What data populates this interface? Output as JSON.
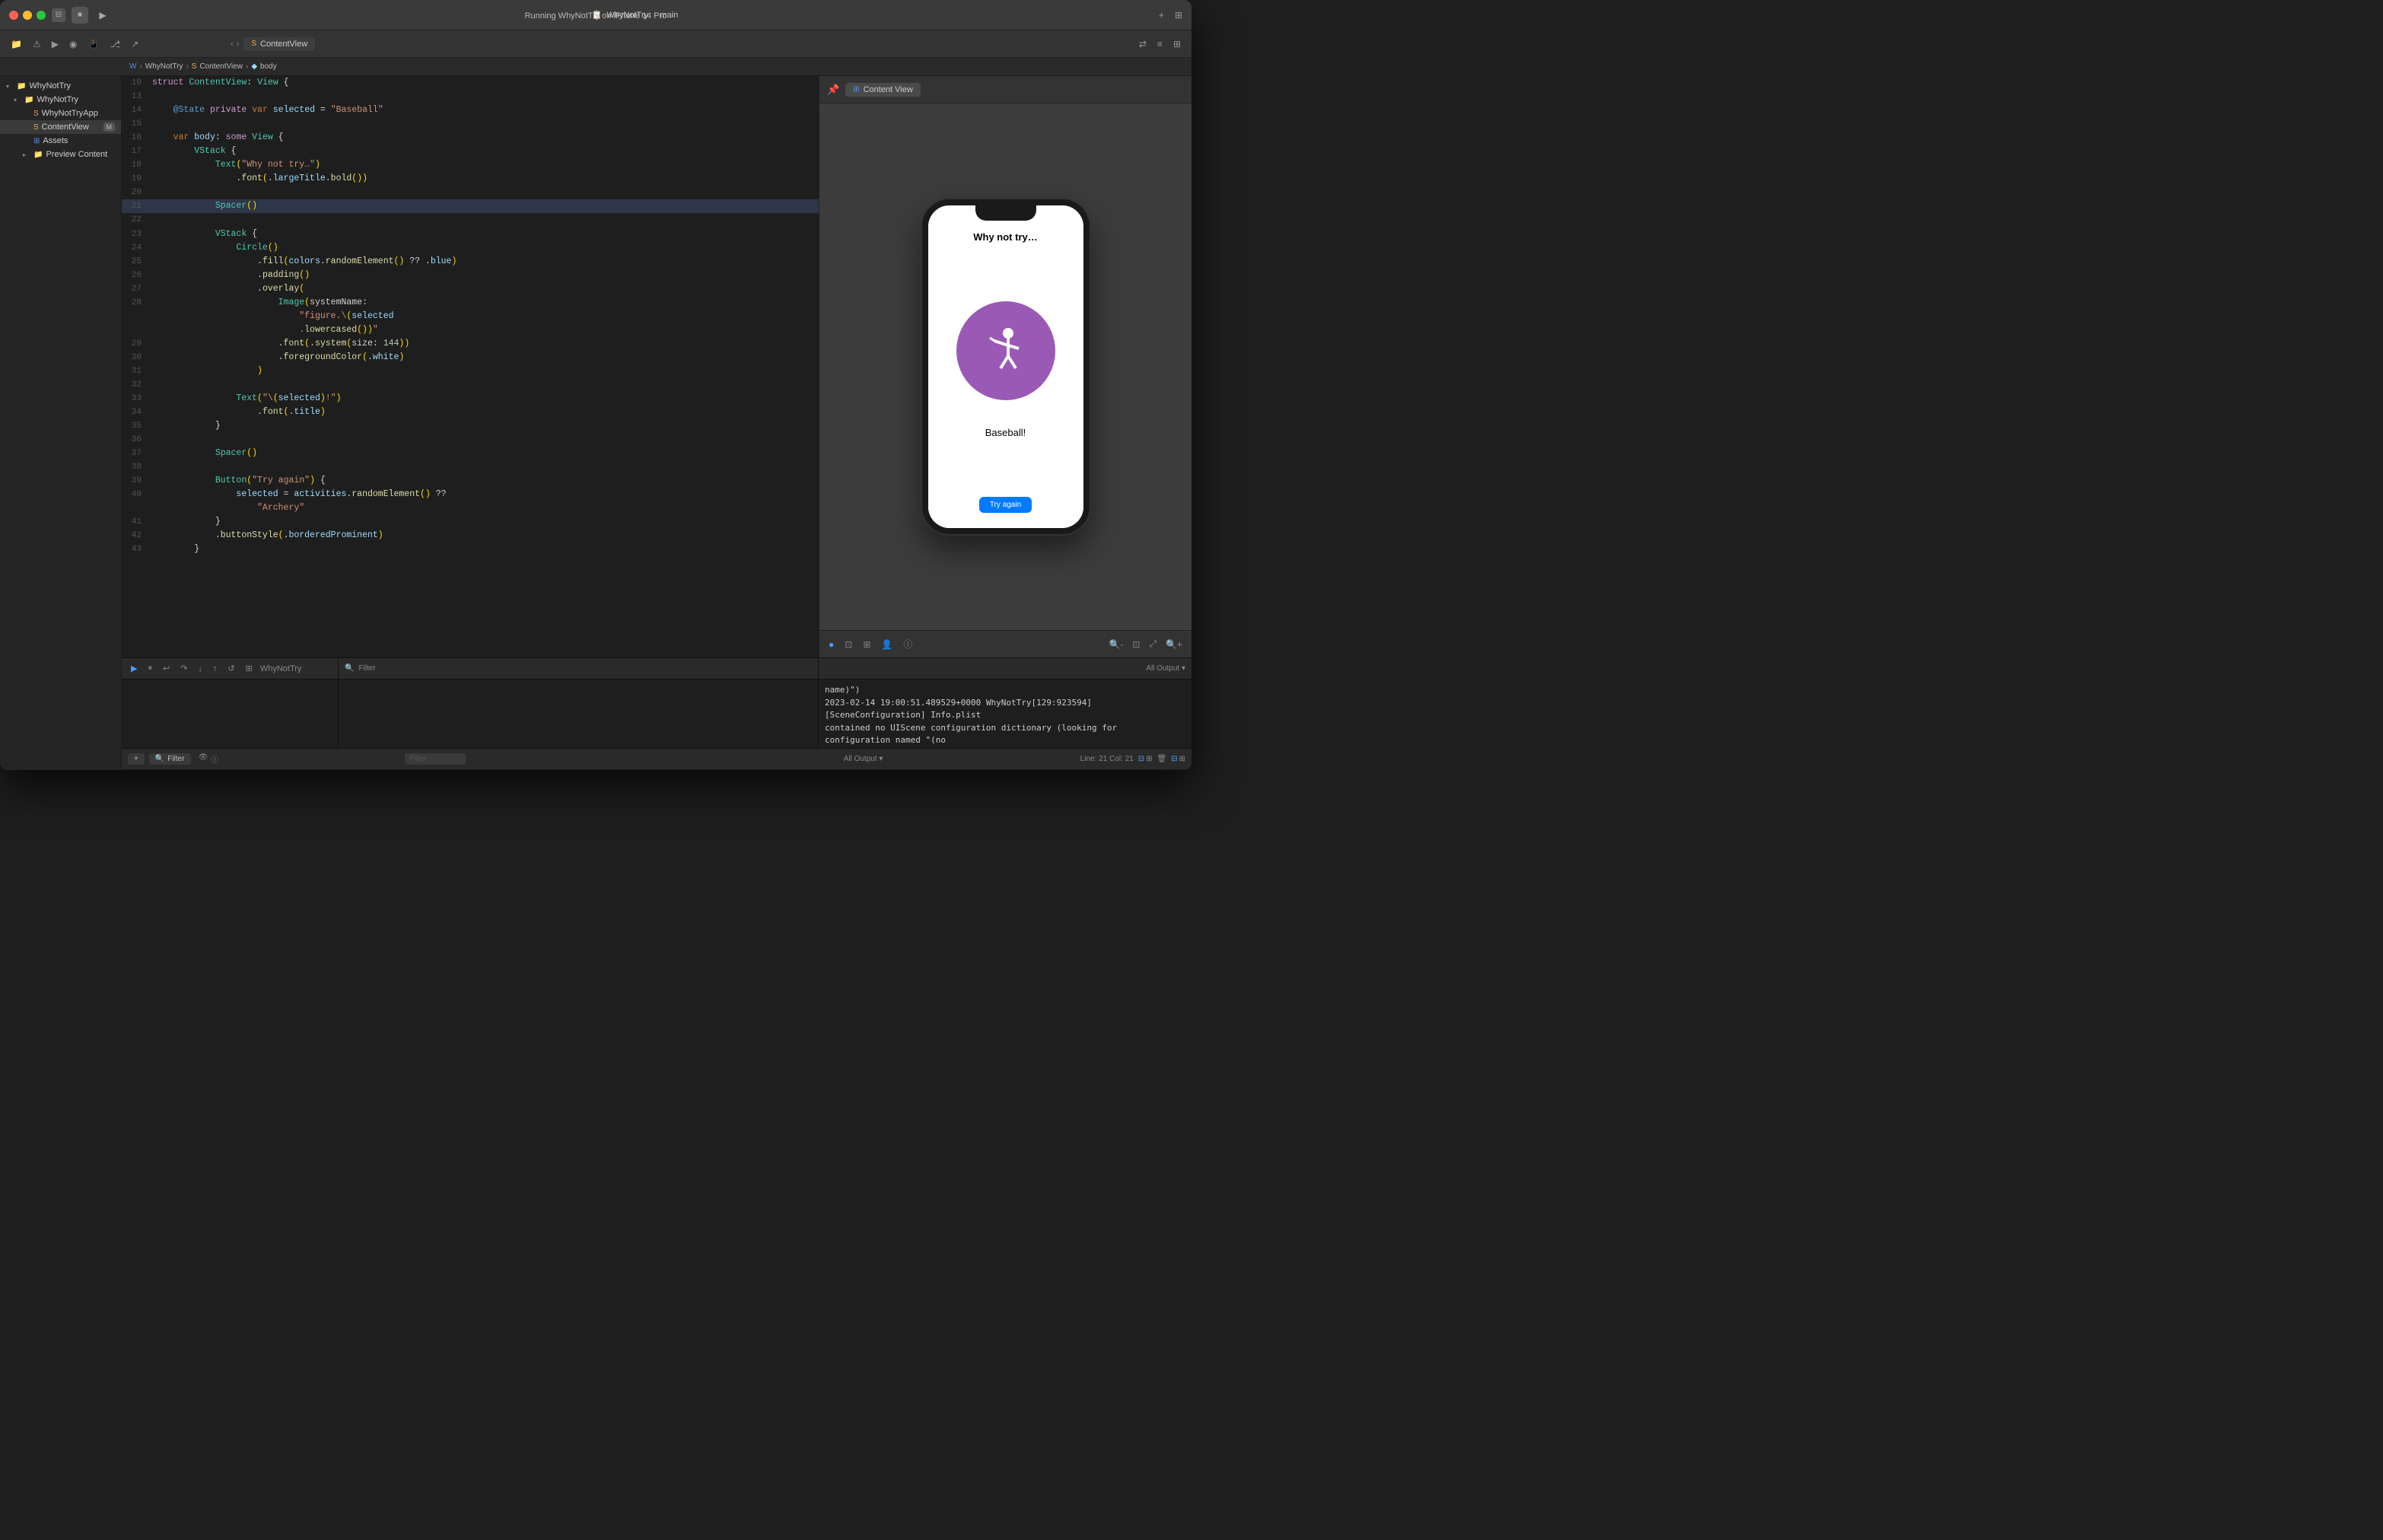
{
  "window": {
    "title": "WhyNotTry",
    "subtitle": "main",
    "status": "Running WhyNotTry on iPhone 14 Pro",
    "device": "iPhone 14 Pro",
    "project": "WhyNotTry"
  },
  "titlebar": {
    "breadcrumb": [
      "WhyNotTry",
      "WhyNotTry",
      "ContentView",
      "body"
    ],
    "tab_label": "ContentView",
    "add_label": "+",
    "layout_label": "⊞"
  },
  "sidebar": {
    "items": [
      {
        "label": "WhyNotTry",
        "level": 0,
        "type": "folder",
        "expanded": true
      },
      {
        "label": "WhyNotTry",
        "level": 1,
        "type": "folder",
        "expanded": true
      },
      {
        "label": "WhyNotTryApp",
        "level": 2,
        "type": "swift"
      },
      {
        "label": "ContentView",
        "level": 2,
        "type": "swift",
        "badge": "M",
        "selected": true
      },
      {
        "label": "Assets",
        "level": 2,
        "type": "assets"
      },
      {
        "label": "Preview Content",
        "level": 2,
        "type": "folder",
        "expanded": false
      }
    ]
  },
  "code": {
    "lines": [
      {
        "num": 10,
        "text": "struct ContentView: View {"
      },
      {
        "num": 13,
        "text": ""
      },
      {
        "num": 14,
        "text": "    @State private var selected = \"Baseball\""
      },
      {
        "num": 15,
        "text": ""
      },
      {
        "num": 16,
        "text": "    var body: some View {"
      },
      {
        "num": 17,
        "text": "        VStack {"
      },
      {
        "num": 18,
        "text": "            Text(\"Why not try…\")"
      },
      {
        "num": 19,
        "text": "                .font(.largeTitle.bold())"
      },
      {
        "num": 20,
        "text": ""
      },
      {
        "num": 21,
        "text": "            Spacer()",
        "highlighted": true
      },
      {
        "num": 22,
        "text": ""
      },
      {
        "num": 23,
        "text": "            VStack {"
      },
      {
        "num": 24,
        "text": "                Circle()"
      },
      {
        "num": 25,
        "text": "                    .fill(colors.randomElement() ?? .blue)"
      },
      {
        "num": 26,
        "text": "                    .padding()"
      },
      {
        "num": 27,
        "text": "                    .overlay("
      },
      {
        "num": 28,
        "text": "                        Image(systemName:"
      },
      {
        "num": 28,
        "text": "                            \"figure.\\(selected"
      },
      {
        "num": 28,
        "text": "                            .lowercased())\")"
      },
      {
        "num": 29,
        "text": "                        .font(.system(size: 144))"
      },
      {
        "num": 30,
        "text": "                        .foregroundColor(.white)"
      },
      {
        "num": 31,
        "text": "                    )"
      },
      {
        "num": 32,
        "text": ""
      },
      {
        "num": 33,
        "text": "                Text(\"\\(selected)!\")"
      },
      {
        "num": 34,
        "text": "                    .font(.title)"
      },
      {
        "num": 35,
        "text": "            }"
      },
      {
        "num": 36,
        "text": ""
      },
      {
        "num": 37,
        "text": "            Spacer()"
      },
      {
        "num": 38,
        "text": ""
      },
      {
        "num": 39,
        "text": "            Button(\"Try again\") {"
      },
      {
        "num": 40,
        "text": "                selected = activities.randomElement() ??"
      },
      {
        "num": 40,
        "text": "                    \"Archery\""
      },
      {
        "num": 41,
        "text": "            }"
      },
      {
        "num": 42,
        "text": "            .buttonStyle(.borderedProminent)"
      },
      {
        "num": 43,
        "text": "        }"
      }
    ]
  },
  "preview": {
    "tab_label": "Content View",
    "iphone": {
      "title": "Why not try…",
      "sport_label": "Baseball!",
      "button_label": "Try again"
    },
    "zoom_icons": [
      "zoom-out",
      "zoom-100",
      "zoom-fit",
      "zoom-in"
    ]
  },
  "bottom": {
    "toolbar_icons": [
      "play",
      "pause",
      "step-back",
      "step-forward",
      "step-into",
      "step-out",
      "debug-break",
      "debug-memory"
    ],
    "scheme_label": "WhyNotTry",
    "output_label": "All Output",
    "filter_label": "Filter",
    "console_lines": [
      {
        "text": "                    name)\")"
      },
      {
        "text": "2023-02-14 19:00:51.489529+0000 WhyNotTry[129:923594] [SceneConfiguration] Info.plist"
      },
      {
        "text": "contained no UIScene configuration dictionary (looking for configuration named \"(no"
      },
      {
        "text": "name)\")"
      }
    ]
  },
  "status_bar": {
    "left_labels": [
      "+",
      "⊕",
      "Filter"
    ],
    "right_labels": [
      "Line: 21  Col: 21"
    ],
    "filter_placeholder": "Filter",
    "output_selector": "All Output ▾"
  }
}
